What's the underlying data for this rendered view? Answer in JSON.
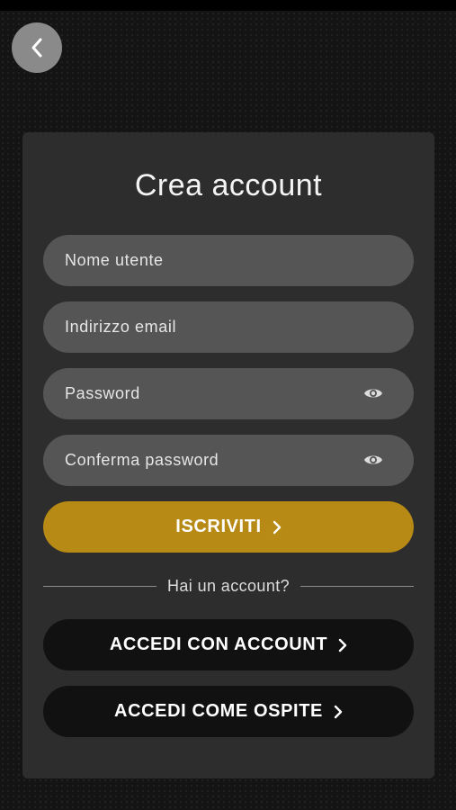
{
  "screen": {
    "title": "Crea account",
    "back_icon": "chevron-left-icon"
  },
  "form": {
    "username_placeholder": "Nome utente",
    "email_placeholder": "Indirizzo email",
    "password_placeholder": "Password",
    "confirm_password_placeholder": "Conferma password",
    "password_toggle_icon": "eye-icon"
  },
  "actions": {
    "signup_label": "ISCRIVITI",
    "divider_text": "Hai un account?",
    "login_label": "ACCEDI CON ACCOUNT",
    "guest_label": "ACCEDI COME OSPITE"
  },
  "colors": {
    "accent": "#b78915",
    "card": "#2d2d2d",
    "field": "#555555",
    "dark_button": "#111111"
  }
}
